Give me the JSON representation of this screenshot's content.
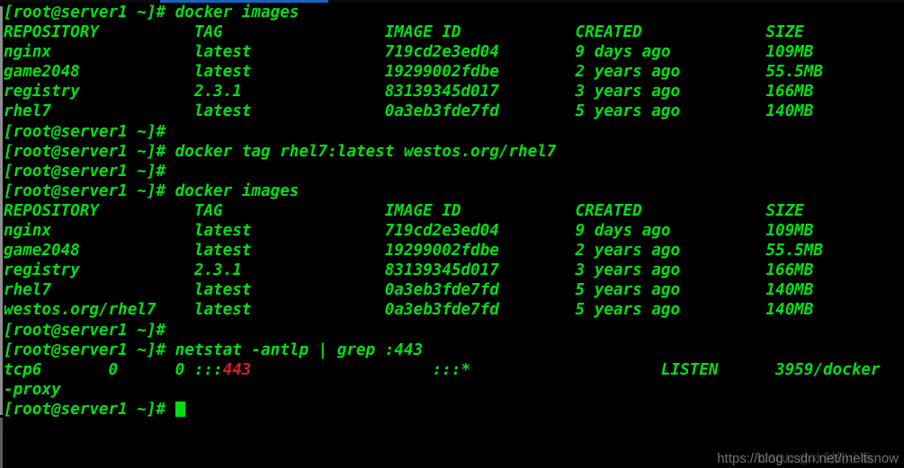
{
  "terminal": {
    "app": "terminal-window",
    "colors": {
      "background": "#000000",
      "foreground": "#00e015",
      "grep_highlight": "#d81f23",
      "top_strip_accent": "#1565c0",
      "scrollbar": "#8f8f8f"
    },
    "prompt": "[root@server1 ~]# ",
    "cursor": "block",
    "lines": [
      {
        "id": "l01",
        "type": "prompt",
        "prompt": "[root@server1 ~]# ",
        "command": "docker images"
      },
      {
        "id": "l02",
        "type": "output",
        "text": "REPOSITORY          TAG                 IMAGE ID            CREATED             SIZE"
      },
      {
        "id": "l03",
        "type": "output",
        "text": "nginx               latest              719cd2e3ed04        9 days ago          109MB"
      },
      {
        "id": "l04",
        "type": "output",
        "text": "game2048            latest              19299002fdbe        2 years ago         55.5MB"
      },
      {
        "id": "l05",
        "type": "output",
        "text": "registry            2.3.1               83139345d017        3 years ago         166MB"
      },
      {
        "id": "l06",
        "type": "output",
        "text": "rhel7               latest              0a3eb3fde7fd        5 years ago         140MB"
      },
      {
        "id": "l07",
        "type": "prompt",
        "prompt": "[root@server1 ~]# ",
        "command": ""
      },
      {
        "id": "l08",
        "type": "prompt",
        "prompt": "[root@server1 ~]# ",
        "command": "docker tag rhel7:latest westos.org/rhel7"
      },
      {
        "id": "l09",
        "type": "prompt",
        "prompt": "[root@server1 ~]# ",
        "command": ""
      },
      {
        "id": "l10",
        "type": "prompt",
        "prompt": "[root@server1 ~]# ",
        "command": "docker images"
      },
      {
        "id": "l11",
        "type": "output",
        "text": "REPOSITORY          TAG                 IMAGE ID            CREATED             SIZE"
      },
      {
        "id": "l12",
        "type": "output",
        "text": "nginx               latest              719cd2e3ed04        9 days ago          109MB"
      },
      {
        "id": "l13",
        "type": "output",
        "text": "game2048            latest              19299002fdbe        2 years ago         55.5MB"
      },
      {
        "id": "l14",
        "type": "output",
        "text": "registry            2.3.1               83139345d017        3 years ago         166MB"
      },
      {
        "id": "l15",
        "type": "output",
        "text": "rhel7               latest              0a3eb3fde7fd        5 years ago         140MB"
      },
      {
        "id": "l16",
        "type": "output",
        "text": "westos.org/rhel7    latest              0a3eb3fde7fd        5 years ago         140MB"
      },
      {
        "id": "l17",
        "type": "prompt",
        "prompt": "[root@server1 ~]# ",
        "command": ""
      },
      {
        "id": "l18",
        "type": "prompt",
        "prompt": "[root@server1 ~]# ",
        "command": "netstat -antlp | grep :443"
      },
      {
        "id": "l19",
        "type": "netstat",
        "pre": "tcp6       0      0 :::",
        "highlight": "443",
        "post": "                   :::*                    LISTEN      3959/docker"
      },
      {
        "id": "l20",
        "type": "output",
        "text": "-proxy"
      },
      {
        "id": "l21",
        "type": "cursor",
        "prompt": "[root@server1 ~]# ",
        "command": ""
      }
    ],
    "tables": [
      {
        "name": "docker-images-before-tag",
        "columns": [
          "REPOSITORY",
          "TAG",
          "IMAGE ID",
          "CREATED",
          "SIZE"
        ],
        "rows": [
          [
            "nginx",
            "latest",
            "719cd2e3ed04",
            "9 days ago",
            "109MB"
          ],
          [
            "game2048",
            "latest",
            "19299002fdbe",
            "2 years ago",
            "55.5MB"
          ],
          [
            "registry",
            "2.3.1",
            "83139345d017",
            "3 years ago",
            "166MB"
          ],
          [
            "rhel7",
            "latest",
            "0a3eb3fde7fd",
            "5 years ago",
            "140MB"
          ]
        ]
      },
      {
        "name": "docker-images-after-tag",
        "columns": [
          "REPOSITORY",
          "TAG",
          "IMAGE ID",
          "CREATED",
          "SIZE"
        ],
        "rows": [
          [
            "nginx",
            "latest",
            "719cd2e3ed04",
            "9 days ago",
            "109MB"
          ],
          [
            "game2048",
            "latest",
            "19299002fdbe",
            "2 years ago",
            "55.5MB"
          ],
          [
            "registry",
            "2.3.1",
            "83139345d017",
            "3 years ago",
            "166MB"
          ],
          [
            "rhel7",
            "latest",
            "0a3eb3fde7fd",
            "5 years ago",
            "140MB"
          ],
          [
            "westos.org/rhel7",
            "latest",
            "0a3eb3fde7fd",
            "5 years ago",
            "140MB"
          ]
        ]
      }
    ],
    "netstat_result": {
      "proto": "tcp6",
      "recv_q": "0",
      "send_q": "0",
      "local_address": ":::443",
      "foreign_address": ":::*",
      "state": "LISTEN",
      "pid_program": "3959/docker-proxy"
    }
  },
  "watermark": {
    "url": "https://blog.csdn.net/meltsnow",
    "logo_text": "CSDN @冰封的小鱼"
  }
}
